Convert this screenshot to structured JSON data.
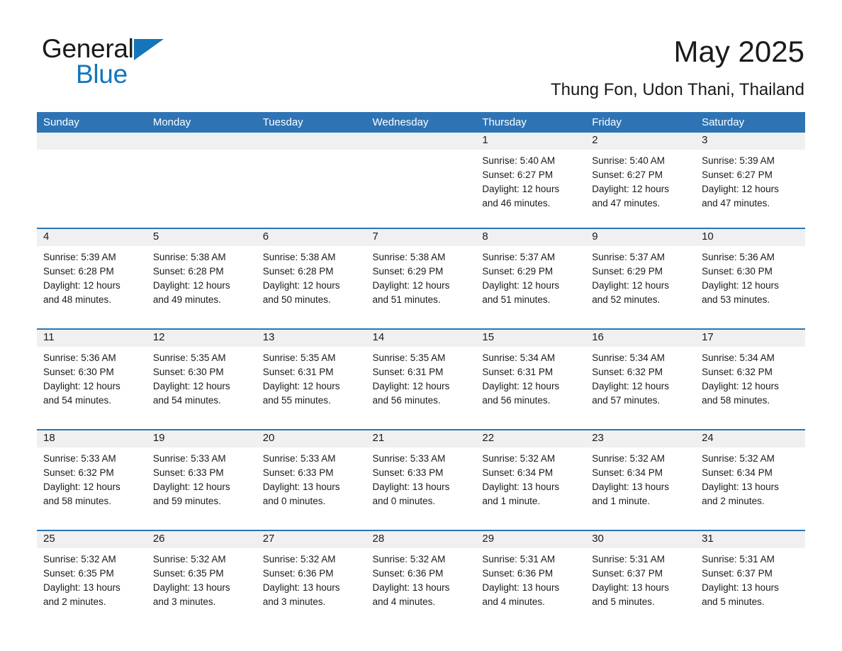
{
  "brand": {
    "name_part1": "General",
    "name_part2": "Blue",
    "triangle_color": "#1575bb",
    "text_color": "#1a1a1a"
  },
  "header": {
    "title": "May 2025",
    "subtitle": "Thung Fon, Udon Thani, Thailand"
  },
  "theme": {
    "header_blue": "#2e74b5",
    "daynum_band": "#f0f0f0",
    "page_background": "#ffffff"
  },
  "calendar": {
    "weekday_headers": [
      "Sunday",
      "Monday",
      "Tuesday",
      "Wednesday",
      "Thursday",
      "Friday",
      "Saturday"
    ],
    "weeks": [
      [
        {
          "day": "",
          "lines": []
        },
        {
          "day": "",
          "lines": []
        },
        {
          "day": "",
          "lines": []
        },
        {
          "day": "",
          "lines": []
        },
        {
          "day": "1",
          "lines": [
            "Sunrise: 5:40 AM",
            "Sunset: 6:27 PM",
            "Daylight: 12 hours",
            "and 46 minutes."
          ]
        },
        {
          "day": "2",
          "lines": [
            "Sunrise: 5:40 AM",
            "Sunset: 6:27 PM",
            "Daylight: 12 hours",
            "and 47 minutes."
          ]
        },
        {
          "day": "3",
          "lines": [
            "Sunrise: 5:39 AM",
            "Sunset: 6:27 PM",
            "Daylight: 12 hours",
            "and 47 minutes."
          ]
        }
      ],
      [
        {
          "day": "4",
          "lines": [
            "Sunrise: 5:39 AM",
            "Sunset: 6:28 PM",
            "Daylight: 12 hours",
            "and 48 minutes."
          ]
        },
        {
          "day": "5",
          "lines": [
            "Sunrise: 5:38 AM",
            "Sunset: 6:28 PM",
            "Daylight: 12 hours",
            "and 49 minutes."
          ]
        },
        {
          "day": "6",
          "lines": [
            "Sunrise: 5:38 AM",
            "Sunset: 6:28 PM",
            "Daylight: 12 hours",
            "and 50 minutes."
          ]
        },
        {
          "day": "7",
          "lines": [
            "Sunrise: 5:38 AM",
            "Sunset: 6:29 PM",
            "Daylight: 12 hours",
            "and 51 minutes."
          ]
        },
        {
          "day": "8",
          "lines": [
            "Sunrise: 5:37 AM",
            "Sunset: 6:29 PM",
            "Daylight: 12 hours",
            "and 51 minutes."
          ]
        },
        {
          "day": "9",
          "lines": [
            "Sunrise: 5:37 AM",
            "Sunset: 6:29 PM",
            "Daylight: 12 hours",
            "and 52 minutes."
          ]
        },
        {
          "day": "10",
          "lines": [
            "Sunrise: 5:36 AM",
            "Sunset: 6:30 PM",
            "Daylight: 12 hours",
            "and 53 minutes."
          ]
        }
      ],
      [
        {
          "day": "11",
          "lines": [
            "Sunrise: 5:36 AM",
            "Sunset: 6:30 PM",
            "Daylight: 12 hours",
            "and 54 minutes."
          ]
        },
        {
          "day": "12",
          "lines": [
            "Sunrise: 5:35 AM",
            "Sunset: 6:30 PM",
            "Daylight: 12 hours",
            "and 54 minutes."
          ]
        },
        {
          "day": "13",
          "lines": [
            "Sunrise: 5:35 AM",
            "Sunset: 6:31 PM",
            "Daylight: 12 hours",
            "and 55 minutes."
          ]
        },
        {
          "day": "14",
          "lines": [
            "Sunrise: 5:35 AM",
            "Sunset: 6:31 PM",
            "Daylight: 12 hours",
            "and 56 minutes."
          ]
        },
        {
          "day": "15",
          "lines": [
            "Sunrise: 5:34 AM",
            "Sunset: 6:31 PM",
            "Daylight: 12 hours",
            "and 56 minutes."
          ]
        },
        {
          "day": "16",
          "lines": [
            "Sunrise: 5:34 AM",
            "Sunset: 6:32 PM",
            "Daylight: 12 hours",
            "and 57 minutes."
          ]
        },
        {
          "day": "17",
          "lines": [
            "Sunrise: 5:34 AM",
            "Sunset: 6:32 PM",
            "Daylight: 12 hours",
            "and 58 minutes."
          ]
        }
      ],
      [
        {
          "day": "18",
          "lines": [
            "Sunrise: 5:33 AM",
            "Sunset: 6:32 PM",
            "Daylight: 12 hours",
            "and 58 minutes."
          ]
        },
        {
          "day": "19",
          "lines": [
            "Sunrise: 5:33 AM",
            "Sunset: 6:33 PM",
            "Daylight: 12 hours",
            "and 59 minutes."
          ]
        },
        {
          "day": "20",
          "lines": [
            "Sunrise: 5:33 AM",
            "Sunset: 6:33 PM",
            "Daylight: 13 hours",
            "and 0 minutes."
          ]
        },
        {
          "day": "21",
          "lines": [
            "Sunrise: 5:33 AM",
            "Sunset: 6:33 PM",
            "Daylight: 13 hours",
            "and 0 minutes."
          ]
        },
        {
          "day": "22",
          "lines": [
            "Sunrise: 5:32 AM",
            "Sunset: 6:34 PM",
            "Daylight: 13 hours",
            "and 1 minute."
          ]
        },
        {
          "day": "23",
          "lines": [
            "Sunrise: 5:32 AM",
            "Sunset: 6:34 PM",
            "Daylight: 13 hours",
            "and 1 minute."
          ]
        },
        {
          "day": "24",
          "lines": [
            "Sunrise: 5:32 AM",
            "Sunset: 6:34 PM",
            "Daylight: 13 hours",
            "and 2 minutes."
          ]
        }
      ],
      [
        {
          "day": "25",
          "lines": [
            "Sunrise: 5:32 AM",
            "Sunset: 6:35 PM",
            "Daylight: 13 hours",
            "and 2 minutes."
          ]
        },
        {
          "day": "26",
          "lines": [
            "Sunrise: 5:32 AM",
            "Sunset: 6:35 PM",
            "Daylight: 13 hours",
            "and 3 minutes."
          ]
        },
        {
          "day": "27",
          "lines": [
            "Sunrise: 5:32 AM",
            "Sunset: 6:36 PM",
            "Daylight: 13 hours",
            "and 3 minutes."
          ]
        },
        {
          "day": "28",
          "lines": [
            "Sunrise: 5:32 AM",
            "Sunset: 6:36 PM",
            "Daylight: 13 hours",
            "and 4 minutes."
          ]
        },
        {
          "day": "29",
          "lines": [
            "Sunrise: 5:31 AM",
            "Sunset: 6:36 PM",
            "Daylight: 13 hours",
            "and 4 minutes."
          ]
        },
        {
          "day": "30",
          "lines": [
            "Sunrise: 5:31 AM",
            "Sunset: 6:37 PM",
            "Daylight: 13 hours",
            "and 5 minutes."
          ]
        },
        {
          "day": "31",
          "lines": [
            "Sunrise: 5:31 AM",
            "Sunset: 6:37 PM",
            "Daylight: 13 hours",
            "and 5 minutes."
          ]
        }
      ]
    ]
  }
}
